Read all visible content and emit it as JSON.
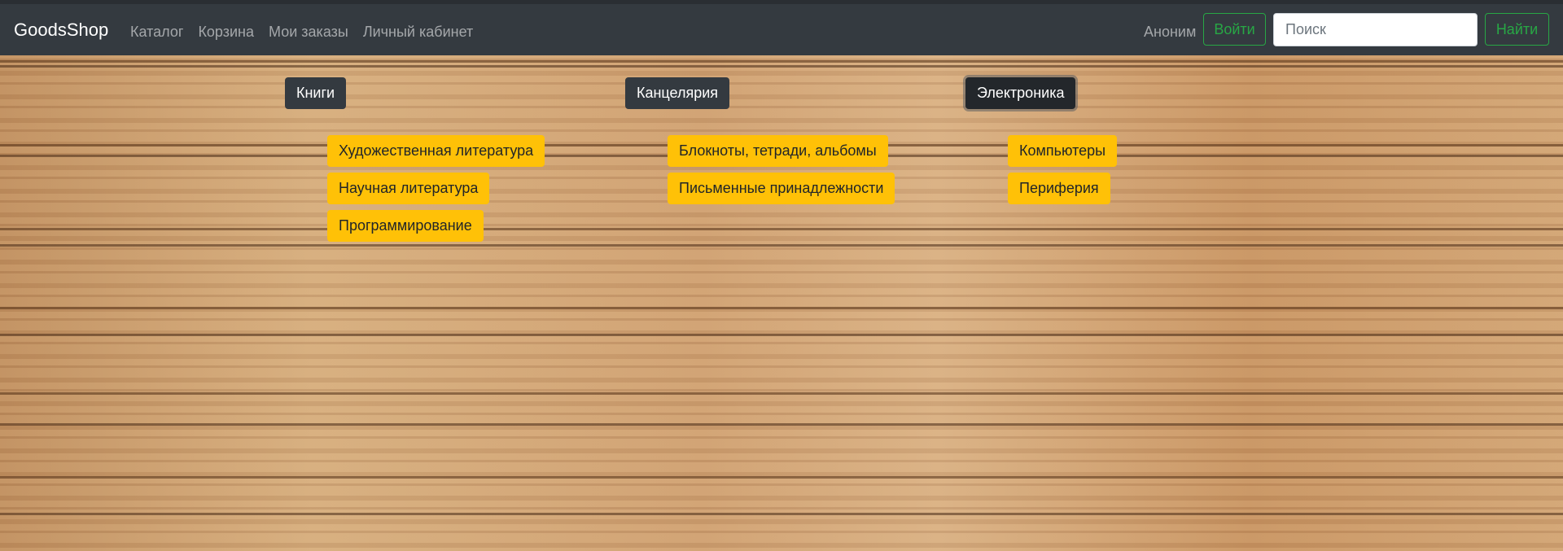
{
  "navbar": {
    "brand": "GoodsShop",
    "links": [
      "Каталог",
      "Корзина",
      "Мои заказы",
      "Личный кабинет"
    ],
    "user": "Аноним",
    "login_label": "Войти",
    "search_placeholder": "Поиск",
    "search_button": "Найти",
    "accent_color": "#28a745"
  },
  "categories": [
    {
      "label": "Книги",
      "subcategories": [
        "Художественная литература",
        "Научная литература",
        "Программирование"
      ]
    },
    {
      "label": "Канцелярия",
      "subcategories": [
        "Блокноты, тетради, альбомы",
        "Письменные принадлежности"
      ]
    },
    {
      "label": "Электроника",
      "active": true,
      "subcategories": [
        "Компьютеры",
        "Периферия"
      ]
    }
  ],
  "colors": {
    "navbar": "#343a40",
    "subcategory_button": "#ffc107"
  }
}
